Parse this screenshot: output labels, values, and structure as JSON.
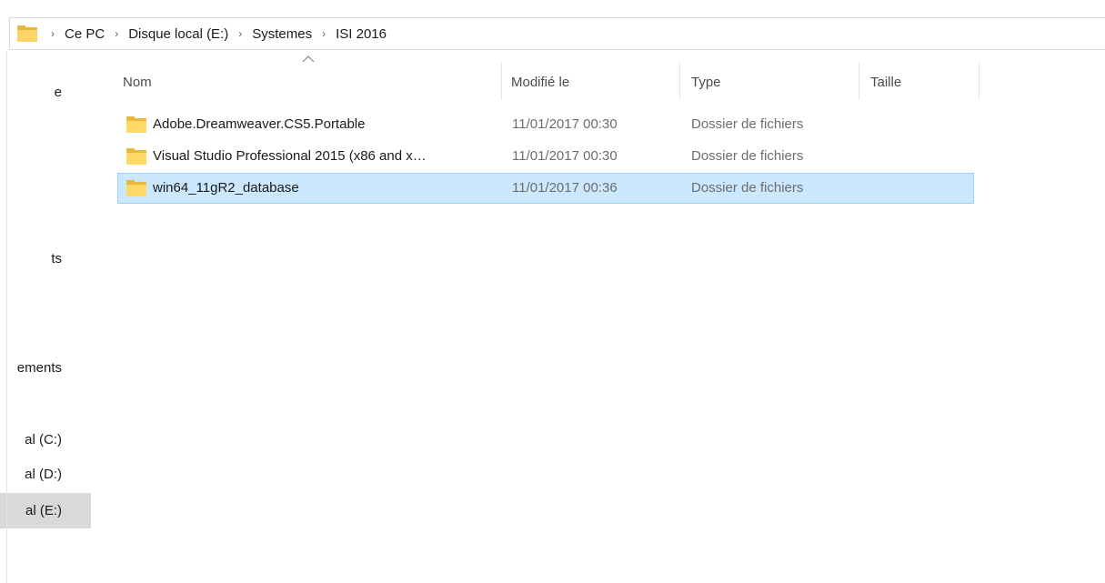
{
  "address_bar": {
    "breadcrumbs": [
      "Ce PC",
      "Disque local (E:)",
      "Systemes",
      "ISI 2016"
    ],
    "separator": "›"
  },
  "nav_pane": {
    "items": [
      {
        "label": "e",
        "selected": false
      },
      {
        "label": "ts",
        "selected": false
      },
      {
        "label": "ements",
        "selected": false
      },
      {
        "label": "al (C:)",
        "selected": false
      },
      {
        "label": "al (D:)",
        "selected": false
      },
      {
        "label": "al (E:)",
        "selected": true
      }
    ]
  },
  "file_list": {
    "sort_indicator": "ascending",
    "columns": [
      "Nom",
      "Modifié le",
      "Type",
      "Taille"
    ],
    "rows": [
      {
        "name": "Adobe.Dreamweaver.CS5.Portable",
        "modified": "11/01/2017 00:30",
        "type": "Dossier de fichiers",
        "size": "",
        "selected": false
      },
      {
        "name": "Visual Studio Professional 2015 (x86 and x…",
        "modified": "11/01/2017 00:30",
        "type": "Dossier de fichiers",
        "size": "",
        "selected": false
      },
      {
        "name": "win64_11gR2_database",
        "modified": "11/01/2017 00:36",
        "type": "Dossier de fichiers",
        "size": "",
        "selected": true
      }
    ]
  },
  "colors": {
    "selection_bg": "#cce8ff",
    "selection_border": "#99d1ff",
    "nav_selected_bg": "#d9d9d9",
    "folder_yellow": "#ffd866"
  }
}
